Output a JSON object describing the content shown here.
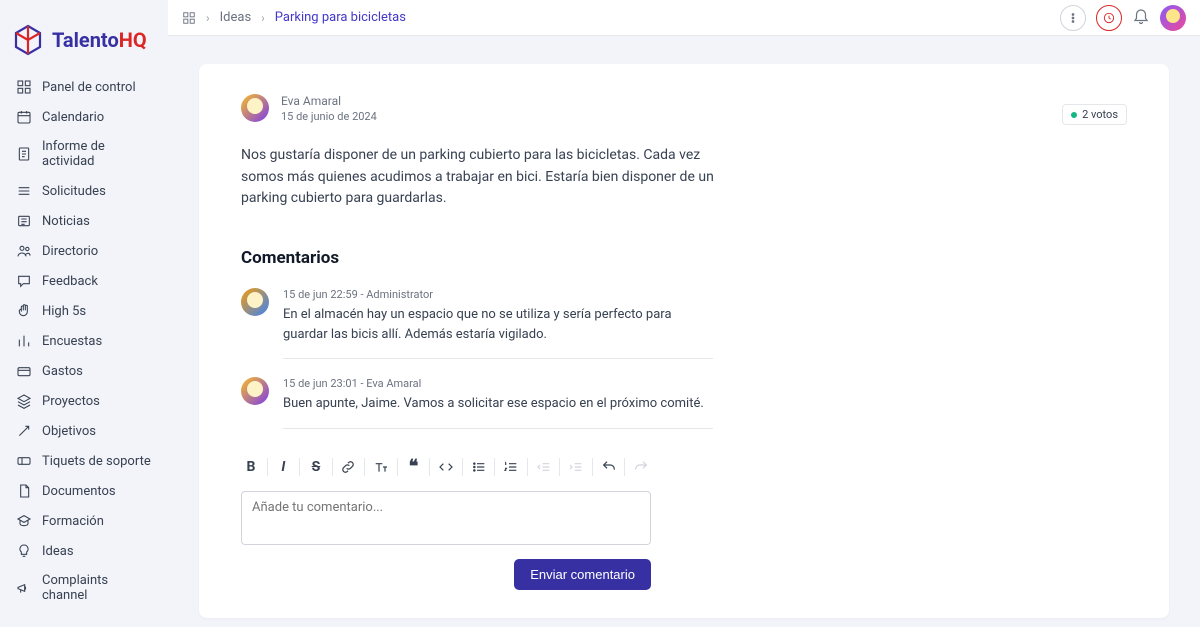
{
  "brand": {
    "name": "Talento",
    "suffix": "HQ"
  },
  "nav": [
    {
      "label": "Panel de control"
    },
    {
      "label": "Calendario"
    },
    {
      "label": "Informe de actividad"
    },
    {
      "label": "Solicitudes"
    },
    {
      "label": "Noticias"
    },
    {
      "label": "Directorio"
    },
    {
      "label": "Feedback"
    },
    {
      "label": "High 5s"
    },
    {
      "label": "Encuestas"
    },
    {
      "label": "Gastos"
    },
    {
      "label": "Proyectos"
    },
    {
      "label": "Objetivos"
    },
    {
      "label": "Tiquets de soporte"
    },
    {
      "label": "Documentos"
    },
    {
      "label": "Formación"
    },
    {
      "label": "Ideas"
    },
    {
      "label": "Complaints channel"
    }
  ],
  "breadcrumb": {
    "section": "Ideas",
    "title": "Parking para bicicletas"
  },
  "post": {
    "author": "Eva Amaral",
    "date": "15 de junio de 2024",
    "body": "Nos gustaría disponer de un parking cubierto para las bicicletas.  Cada vez somos más quienes acudimos a trabajar en bici. Estaría bien disponer de un parking cubierto para guardarlas.",
    "votes": "2 votos"
  },
  "comments_title": "Comentarios",
  "comments": [
    {
      "meta": "15 de jun 22:59 - Administrator",
      "text": "En el almacén hay un espacio que no se utiliza y sería perfecto para guardar las bicis allí.  Además estaría vigilado."
    },
    {
      "meta": "15 de jun 23:01 - Eva Amaral",
      "text": "Buen apunte, Jaime.  Vamos a solicitar ese espacio en el próximo comité."
    }
  ],
  "editor": {
    "placeholder": "Añade tu comentario...",
    "submit": "Enviar comentario"
  }
}
